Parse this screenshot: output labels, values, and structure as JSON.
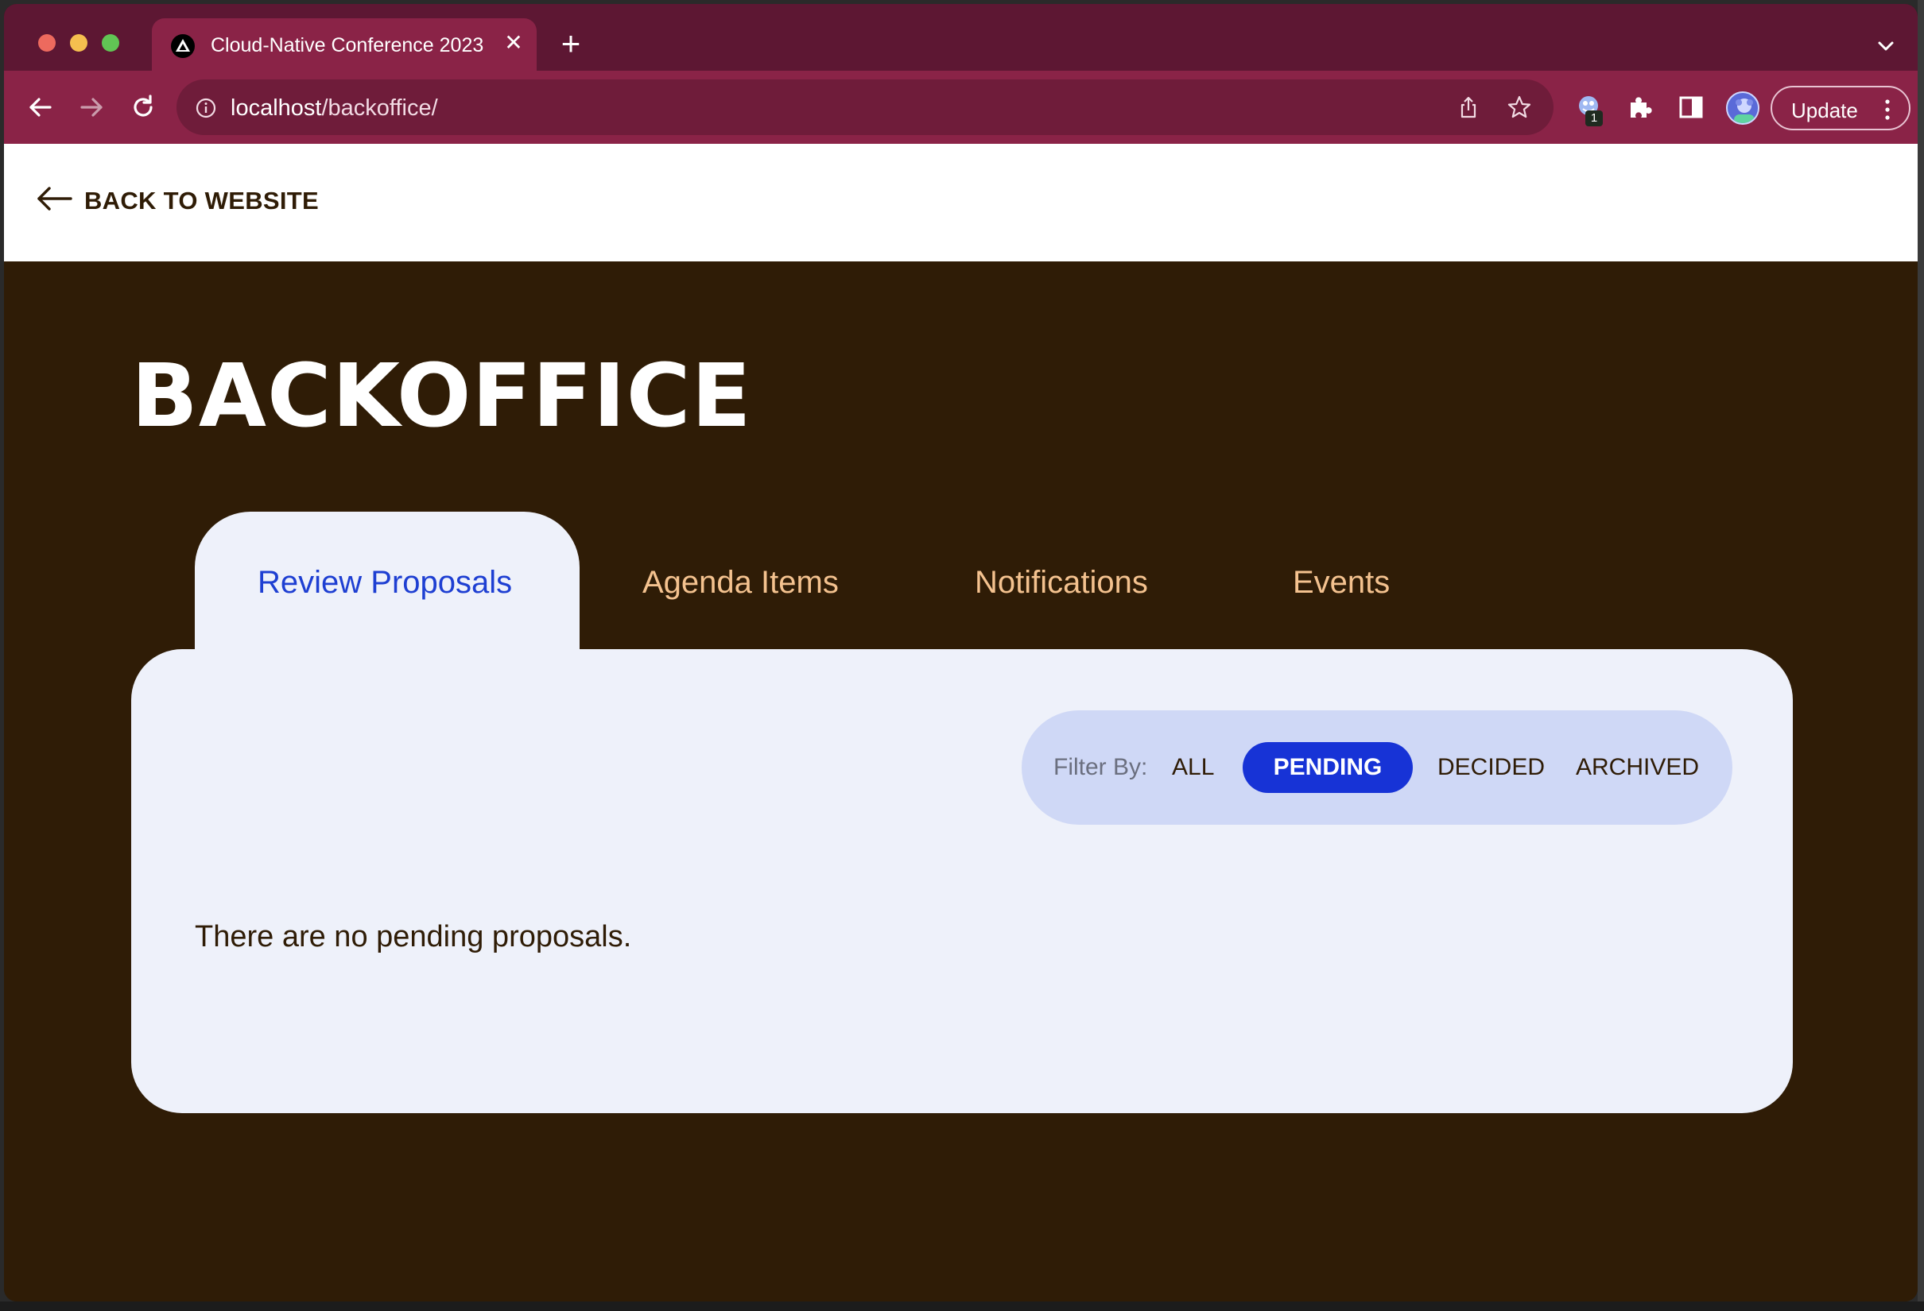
{
  "browser": {
    "tab_title": "Cloud-Native Conference 2023",
    "tab_close": "✕",
    "new_tab": "+",
    "url_host": "localhost",
    "url_path": "/backoffice/",
    "extension_badge": "1",
    "update_label": "Update",
    "accent": "#8a2347"
  },
  "page": {
    "back_label": "BACK TO WEBSITE",
    "title": "BACKOFFICE",
    "tabs": [
      {
        "label": "Review Proposals",
        "active": true
      },
      {
        "label": "Agenda Items",
        "active": false
      },
      {
        "label": "Notifications",
        "active": false
      },
      {
        "label": "Events",
        "active": false
      }
    ],
    "filter": {
      "label": "Filter By:",
      "options": [
        "ALL",
        "PENDING",
        "DECIDED",
        "ARCHIVED"
      ],
      "selected": "PENDING"
    },
    "empty_message": "There are no pending proposals.",
    "colors": {
      "background": "#2f1c06",
      "panel": "#eef1fa",
      "active_tab_text": "#1e3fd2",
      "inactive_tab_text": "#f4c28f",
      "filter_pill": "#1733d6"
    }
  },
  "icons": [
    "back-icon",
    "forward-icon",
    "reload-icon",
    "info-icon",
    "share-icon",
    "star-icon",
    "extension-icon",
    "puzzle-icon",
    "side-panel-icon",
    "avatar",
    "more-vert-icon",
    "arrow-left-icon",
    "chevron-down-icon",
    "favicon-triangle-icon"
  ]
}
